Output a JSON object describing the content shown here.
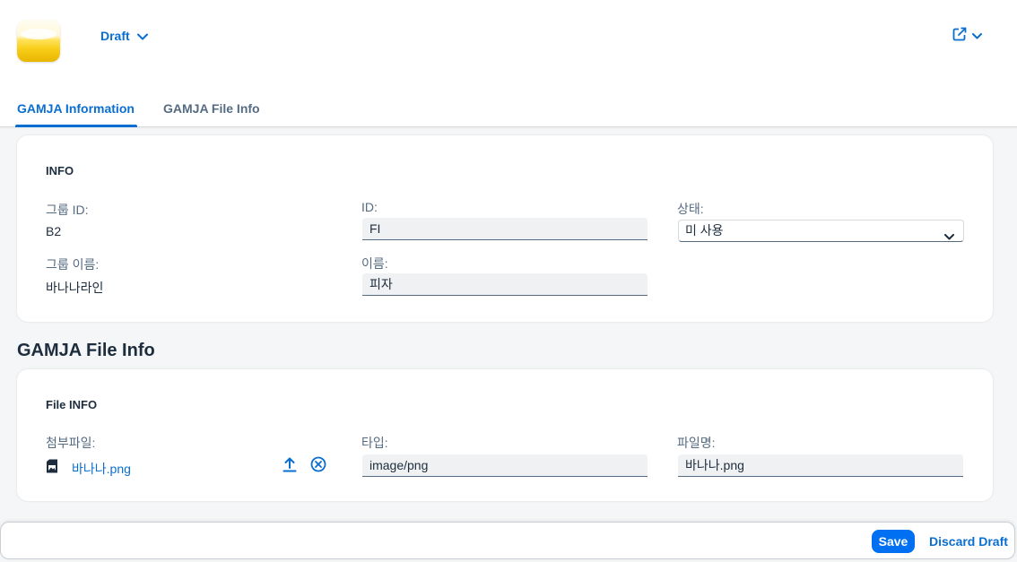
{
  "header": {
    "app_icon": "banana-app-icon",
    "draft_label": "Draft",
    "share_icon": "share-icon"
  },
  "tabs": [
    {
      "label": "GAMJA Information",
      "selected": true
    },
    {
      "label": "GAMJA File Info",
      "selected": false
    }
  ],
  "info_section": {
    "title": "INFO",
    "group_id_label": "그룹 ID:",
    "group_id_value": "B2",
    "group_name_label": "그룹 이름:",
    "group_name_value": "바나나라인",
    "id_label": "ID:",
    "id_value": "FI",
    "name_label": "이름:",
    "name_value": "피자",
    "status_label": "상태:",
    "status_value": "미 사용"
  },
  "file_section": {
    "heading": "GAMJA File Info",
    "title": "File INFO",
    "attachment_label": "첨부파일:",
    "attachment_file": "바나나.png",
    "type_label": "타입:",
    "type_value": "image/png",
    "filename_label": "파일명:",
    "filename_value": "바나나.png"
  },
  "footer": {
    "save_label": "Save",
    "discard_label": "Discard Draft"
  },
  "colors": {
    "accent": "#0a6ed1",
    "save_button": "#0070f2",
    "background": "#f5f6f7"
  }
}
